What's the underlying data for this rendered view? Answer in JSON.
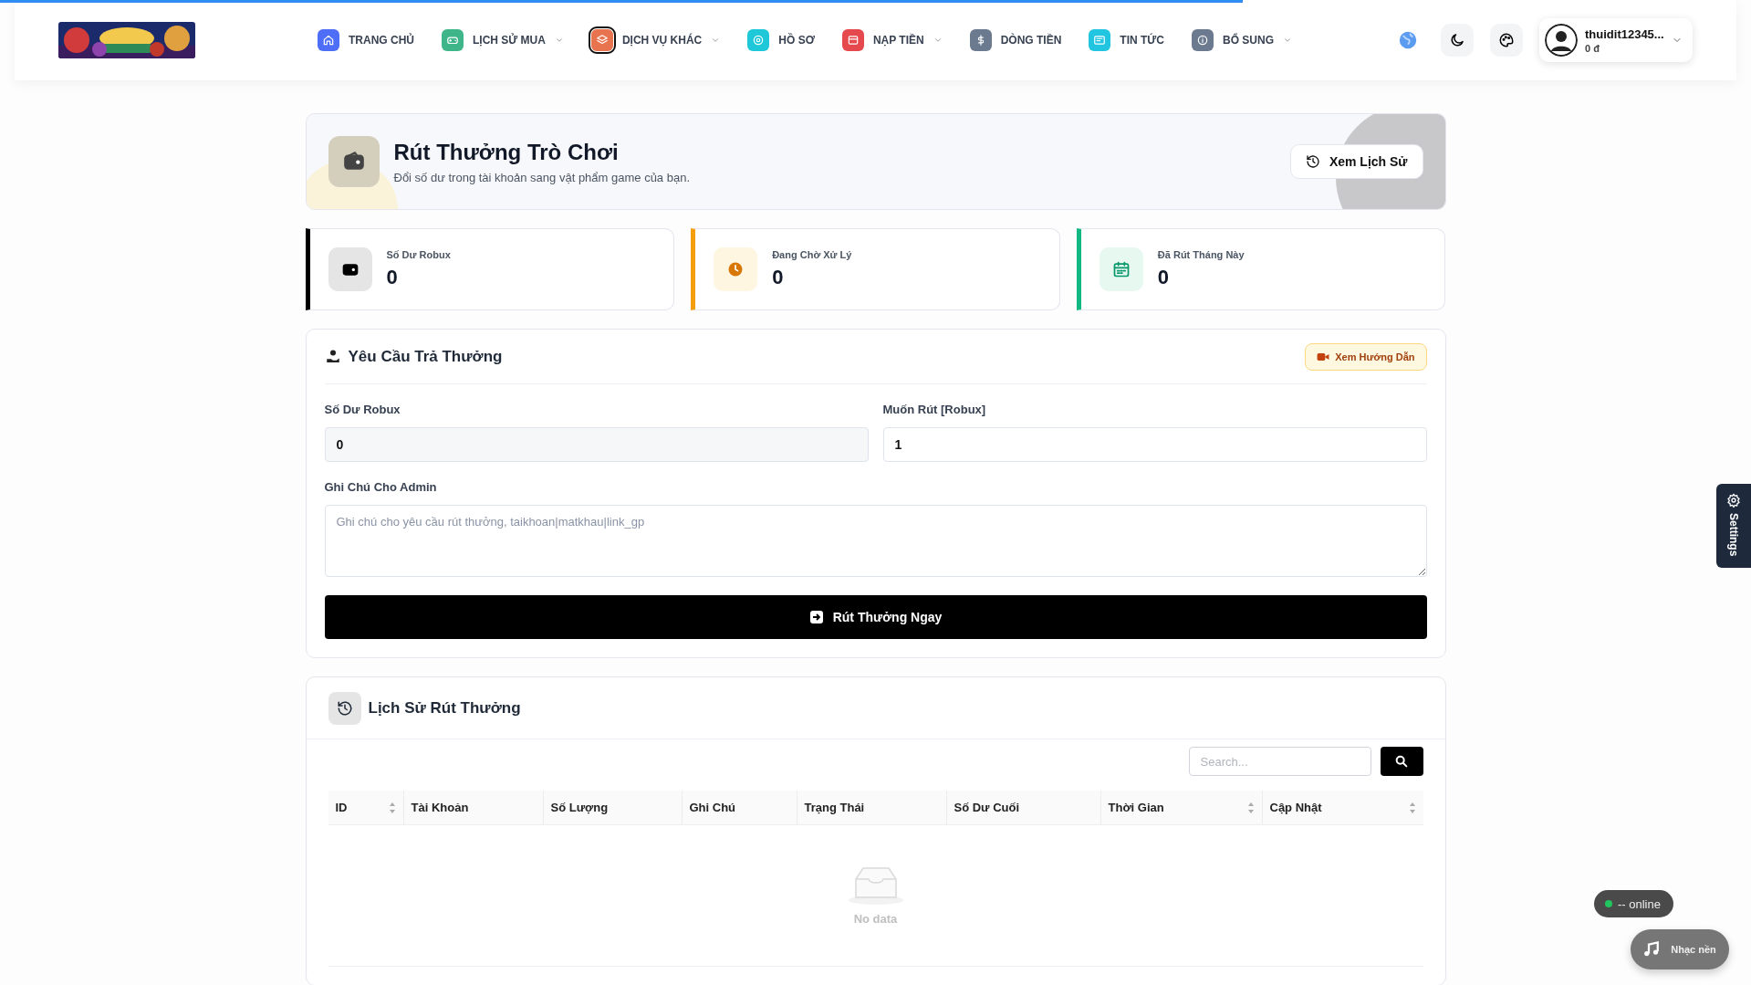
{
  "loading_bar": {
    "level": 0.71
  },
  "header": {
    "nav": [
      {
        "label": "TRANG CHỦ",
        "color": "#4f6ef7",
        "dropdown": false,
        "selected": false
      },
      {
        "label": "LỊCH SỬ MUA",
        "color": "#3fb58a",
        "dropdown": true,
        "selected": false
      },
      {
        "label": "DỊCH VỤ KHÁC",
        "color": "#e8744f",
        "dropdown": true,
        "selected": true
      },
      {
        "label": "HỒ SƠ",
        "color": "#1fc8d8",
        "dropdown": false,
        "selected": false
      },
      {
        "label": "NẠP TIỀN",
        "color": "#e5484d",
        "dropdown": true,
        "selected": false
      },
      {
        "label": "DÒNG TIỀN",
        "color": "#6b7a8f",
        "dropdown": false,
        "selected": false
      },
      {
        "label": "TIN TỨC",
        "color": "#22c5e0",
        "dropdown": false,
        "selected": false
      },
      {
        "label": "BỔ SUNG",
        "color": "#6b7a8f",
        "dropdown": true,
        "selected": false
      }
    ],
    "user": {
      "name": "thuidit12345...",
      "balance": "0 đ"
    }
  },
  "page_header": {
    "title": "Rút Thưởng Trò Chơi",
    "subtitle": "Đổi số dư trong tài khoản sang vật phẩm game của bạn.",
    "history_button": "Xem Lịch Sử"
  },
  "stats": [
    {
      "label": "Số Dư Robux",
      "value": "0",
      "color": "#000000"
    },
    {
      "label": "Đang Chờ Xử Lý",
      "value": "0",
      "color": "#f59e0b"
    },
    {
      "label": "Đã Rút Tháng Này",
      "value": "0",
      "color": "#10b981"
    }
  ],
  "request_form": {
    "title": "Yêu Cầu Trả Thưởng",
    "guide_button": "Xem Hướng Dẫn",
    "balance_label": "Số Dư Robux",
    "balance_value": "0",
    "amount_label": "Muốn Rút [Robux]",
    "amount_value": "1",
    "note_label": "Ghi Chú Cho Admin",
    "note_placeholder": "Ghi chú cho yêu cầu rút thưởng, taikhoan|matkhau|link_gp",
    "submit": "Rút Thưởng Ngay"
  },
  "history": {
    "title": "Lịch Sử Rút Thưởng",
    "search_placeholder": "Search...",
    "columns": [
      {
        "label": "ID",
        "sortable": true
      },
      {
        "label": "Tài Khoản",
        "sortable": false
      },
      {
        "label": "Số Lượng",
        "sortable": false
      },
      {
        "label": "Ghi Chú",
        "sortable": false
      },
      {
        "label": "Trạng Thái",
        "sortable": false
      },
      {
        "label": "Số Dư Cuối",
        "sortable": false
      },
      {
        "label": "Thời Gian",
        "sortable": true
      },
      {
        "label": "Cập Nhật",
        "sortable": true
      }
    ],
    "empty": "No data"
  },
  "settings_tab": "Settings",
  "online": {
    "text": "-- online",
    "color": "#22c55e"
  },
  "music_button": "Nhạc nền"
}
